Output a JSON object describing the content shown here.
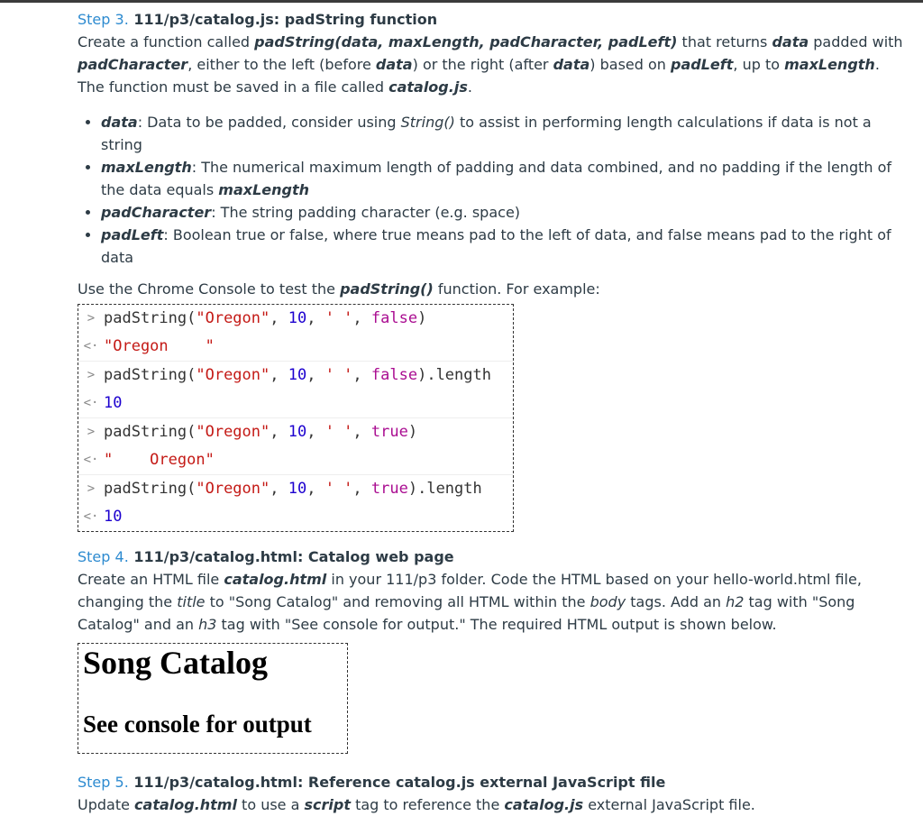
{
  "step3": {
    "number": "Step 3.",
    "title": "111/p3/catalog.js: padString function",
    "intro": [
      {
        "t": "Create a function called "
      },
      {
        "t": "padString(data, maxLength, padCharacter, padLeft)",
        "bi": true
      },
      {
        "t": " that returns "
      },
      {
        "t": "data",
        "bi": true
      },
      {
        "t": " padded with "
      },
      {
        "t": "padCharacter",
        "bi": true
      },
      {
        "t": ", either to the left (before "
      },
      {
        "t": "data",
        "bi": true
      },
      {
        "t": ") or the right (after "
      },
      {
        "t": "data",
        "bi": true
      },
      {
        "t": ") based on "
      },
      {
        "t": "padLeft",
        "bi": true
      },
      {
        "t": ", up to "
      },
      {
        "t": "maxLength",
        "bi": true
      },
      {
        "t": ". The function must be saved in a file called "
      },
      {
        "t": "catalog.js",
        "bi": true
      },
      {
        "t": "."
      }
    ],
    "bullets": [
      {
        "term": "data",
        "text": ": Data to be padded, consider using ",
        "extra": "String()",
        "rest": " to assist in performing length calculations if data is not a string"
      },
      {
        "term": "maxLength",
        "text": ": The numerical maximum length of padding and data combined, and no padding if the length of the data equals ",
        "extra_bold": "maxLength",
        "rest": ""
      },
      {
        "term": "padCharacter",
        "text": ": The string padding character (e.g. space)",
        "rest": ""
      },
      {
        "term": "padLeft",
        "text": ": Boolean true or false, where true means pad to the left of data, and false means pad to the right of data",
        "rest": ""
      }
    ],
    "test_prefix": "Use the Chrome Console to test the ",
    "test_fn": "padString()",
    "test_suffix": " function. For example:"
  },
  "console": [
    {
      "type": "in",
      "fn": "padString(",
      "str": "\"Oregon\"",
      "c1": ", ",
      "num": "10",
      "c2": ", ",
      "ch": "' '",
      "c3": ", ",
      "bool": "false",
      "end": ")"
    },
    {
      "type": "out",
      "str": "\"Oregon    \""
    },
    {
      "type": "in",
      "fn": "padString(",
      "str": "\"Oregon\"",
      "c1": ", ",
      "num": "10",
      "c2": ", ",
      "ch": "' '",
      "c3": ", ",
      "bool": "false",
      "end": ").length"
    },
    {
      "type": "outnum",
      "num": "10"
    },
    {
      "type": "in",
      "fn": "padString(",
      "str": "\"Oregon\"",
      "c1": ", ",
      "num": "10",
      "c2": ", ",
      "ch": "' '",
      "c3": ", ",
      "bool": "true",
      "end": ")"
    },
    {
      "type": "out",
      "str": "\"    Oregon\""
    },
    {
      "type": "in",
      "fn": "padString(",
      "str": "\"Oregon\"",
      "c1": ", ",
      "num": "10",
      "c2": ", ",
      "ch": "' '",
      "c3": ", ",
      "bool": "true",
      "end": ").length"
    },
    {
      "type": "outnum",
      "num": "10"
    }
  ],
  "step4": {
    "number": "Step 4.",
    "title": "111/p3/catalog.html: Catalog web page",
    "body": [
      {
        "t": "Create an HTML file "
      },
      {
        "t": "catalog.html",
        "bi": true
      },
      {
        "t": " in your 111/p3 folder. Code the HTML based on your hello-world.html file, changing the "
      },
      {
        "t": "title",
        "i": true
      },
      {
        "t": " to \"Song Catalog\" and removing all HTML within the "
      },
      {
        "t": "body",
        "i": true
      },
      {
        "t": " tags. Add an "
      },
      {
        "t": "h2",
        "i": true
      },
      {
        "t": " tag with \"Song Catalog\" and an "
      },
      {
        "t": "h3",
        "i": true
      },
      {
        "t": " tag with \"See console for output.\" The required HTML output is shown below."
      }
    ],
    "preview_h2": "Song Catalog",
    "preview_h3": "See console for output"
  },
  "step5": {
    "number": "Step 5.",
    "title": "111/p3/catalog.html: Reference catalog.js external JavaScript file",
    "body": [
      {
        "t": "Update "
      },
      {
        "t": "catalog.html",
        "bi": true
      },
      {
        "t": " to use a "
      },
      {
        "t": "script",
        "bi": true
      },
      {
        "t": " tag to reference the "
      },
      {
        "t": "catalog.js",
        "bi": true
      },
      {
        "t": " external JavaScript file."
      }
    ]
  }
}
